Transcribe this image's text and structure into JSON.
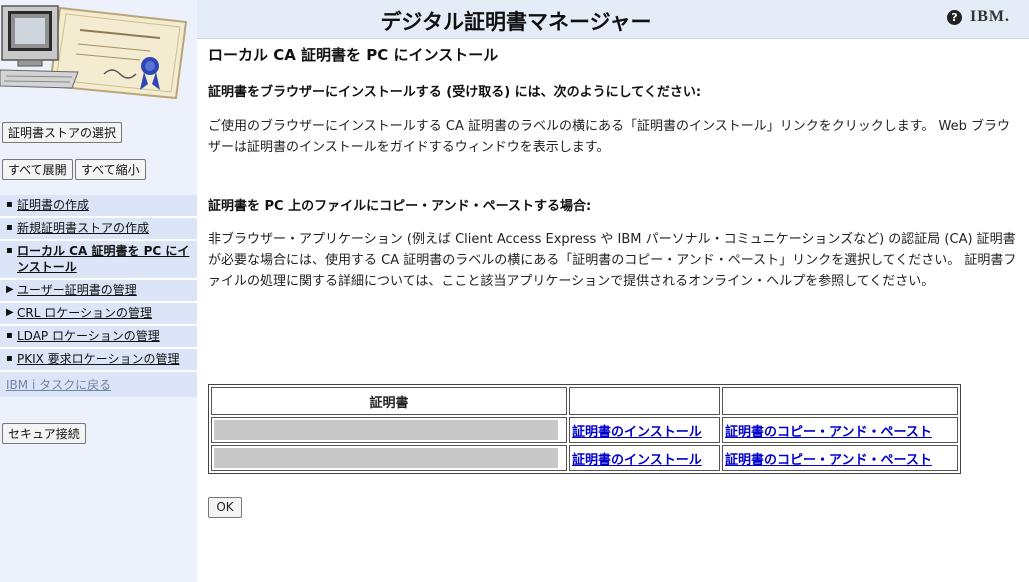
{
  "header": {
    "title": "デジタル証明書マネージャー",
    "help_glyph": "?",
    "brand": "IBM."
  },
  "sidebar": {
    "select_store_button": "証明書ストアの選択",
    "expand_all_button": "すべて展開",
    "collapse_all_button": "すべて縮小",
    "nav_items": [
      {
        "label": "証明書の作成",
        "marker": "▪"
      },
      {
        "label": "新規証明書ストアの作成",
        "marker": "▪"
      },
      {
        "label": "ローカル CA 証明書を PC にインストール",
        "marker": "▪"
      },
      {
        "label": "ユーザー証明書の管理",
        "marker": "▶"
      },
      {
        "label": "CRL ロケーションの管理",
        "marker": "▶"
      },
      {
        "label": "LDAP ロケーションの管理",
        "marker": "▪"
      },
      {
        "label": "PKIX 要求ロケーションの管理",
        "marker": "▪"
      }
    ],
    "back_link": "IBM i タスクに戻る",
    "secure_button": "セキュア接続"
  },
  "main": {
    "page_title": "ローカル CA 証明書を PC にインストール",
    "section1_heading": "証明書をブラウザーにインストールする (受け取る) には、次のようにしてください:",
    "section1_text": "ご使用のブラウザーにインストールする CA 証明書のラベルの横にある「証明書のインストール」リンクをクリックします。 Web ブラウザーは証明書のインストールをガイドするウィンドウを表示します。",
    "section2_heading": "証明書を PC 上のファイルにコピー・アンド・ペーストする場合:",
    "section2_text": "非ブラウザー・アプリケーション (例えば Client Access Express や IBM パーソナル・コミュニケーションズなど) の認証局 (CA) 証明書が必要な場合には、使用する CA 証明書のラベルの横にある「証明書のコピー・アンド・ペースト」リンクを選択してください。 証明書ファイルの処理に関する詳細については、ここと該当アプリケーションで提供されるオンライン・ヘルプを参照してください。",
    "table": {
      "header": "証明書",
      "rows": [
        {
          "install_link": "証明書のインストール",
          "copy_link": "証明書のコピー・アンド・ペースト"
        },
        {
          "install_link": "証明書のインストール",
          "copy_link": "証明書のコピー・アンド・ペースト"
        }
      ]
    },
    "ok_button": "OK"
  }
}
